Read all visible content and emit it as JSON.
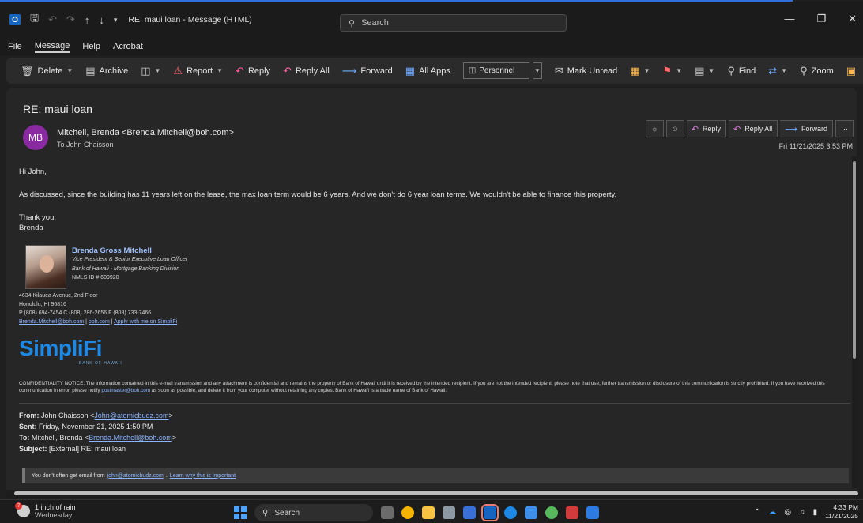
{
  "window": {
    "title": "RE: maui loan  -  Message (HTML)",
    "search_placeholder": "Search",
    "app_badge": "O"
  },
  "menu": [
    "File",
    "Message",
    "Help",
    "Acrobat"
  ],
  "ribbon": {
    "delete": "Delete",
    "archive": "Archive",
    "report": "Report",
    "reply": "Reply",
    "reply_all": "Reply All",
    "forward": "Forward",
    "all_apps": "All Apps",
    "folder": "Personnel",
    "mark_unread": "Mark Unread",
    "find": "Find",
    "zoom": "Zoom",
    "more": "···"
  },
  "message": {
    "subject": "RE: maui loan",
    "avatar_initials": "MB",
    "from": "Mitchell, Brenda <Brenda.Mitchell@boh.com>",
    "to": "To  John Chaisson",
    "date": "Fri 11/21/2025 3:53 PM",
    "actions": {
      "reply": "Reply",
      "reply_all": "Reply All",
      "forward": "Forward",
      "more": "···"
    },
    "greeting": "Hi John,",
    "body": "As discussed, since the building has 11 years left on the lease, the max loan term would be 6 years. And we don't do 6 year loan terms. We wouldn't be able to finance this property.",
    "closing": "Thank you,",
    "closing_name": "Brenda"
  },
  "signature": {
    "name": "Brenda Gross Mitchell",
    "title": "Vice President & Senior Executive Loan Officer",
    "division": "Bank of Hawaii - Mortgage Banking Division",
    "nmls": "NMLS ID # 609920",
    "address1": "4634 Kilauea Avenue, 2nd Floor",
    "address2": "Honolulu, HI  96816",
    "phones": "P (808) 694-7454  C (808) 286-2656  F (808) 733-7466",
    "email": "Brenda.Mitchell@boh.com",
    "sep1": "  |  ",
    "website": "boh.com",
    "sep2": "  |  ",
    "apply": "Apply with me on SimpliFi",
    "logo": "SimpliFi",
    "logo_sub": "BANK OF HAWAII"
  },
  "confidential": {
    "text1": "CONFIDENTIALITY NOTICE: The information contained in this e-mail transmission and any attachment is confidential and remains the property of Bank of Hawaii until it is received by the intended recipient. If you are not the intended recipient, please note that use, further transmission or disclosure of this communication is strictly prohibited. If you have received this communication in error, please notify ",
    "link": "postmaster@boh.com",
    "text2": " as soon as possible, and delete it from your computer without retaining any copies. Bank of Hawai'i is a trade name of Bank of Hawaii."
  },
  "quoted": {
    "from_label": "From:",
    "from_name": " John Chaisson <",
    "from_email": "John@atomicbudz.com",
    "from_end": ">",
    "sent_label": "Sent:",
    "sent": " Friday, November 21, 2025 1:50 PM",
    "to_label": "To:",
    "to_name": " Mitchell, Brenda <",
    "to_email": "Brenda.Mitchell@boh.com",
    "to_end": ">",
    "subject_label": "Subject:",
    "subject": " [External] RE: maui loan"
  },
  "warning": {
    "text": "You don't often get email from ",
    "email": "john@atomicbudz.com",
    "dot": ". ",
    "link": "Learn why this is important"
  },
  "taskbar": {
    "weather_badge": "7",
    "weather_line1": "1 inch of rain",
    "weather_line2": "Wednesday",
    "search": "Search",
    "time": "4:33 PM",
    "date": "11/21/2025"
  }
}
